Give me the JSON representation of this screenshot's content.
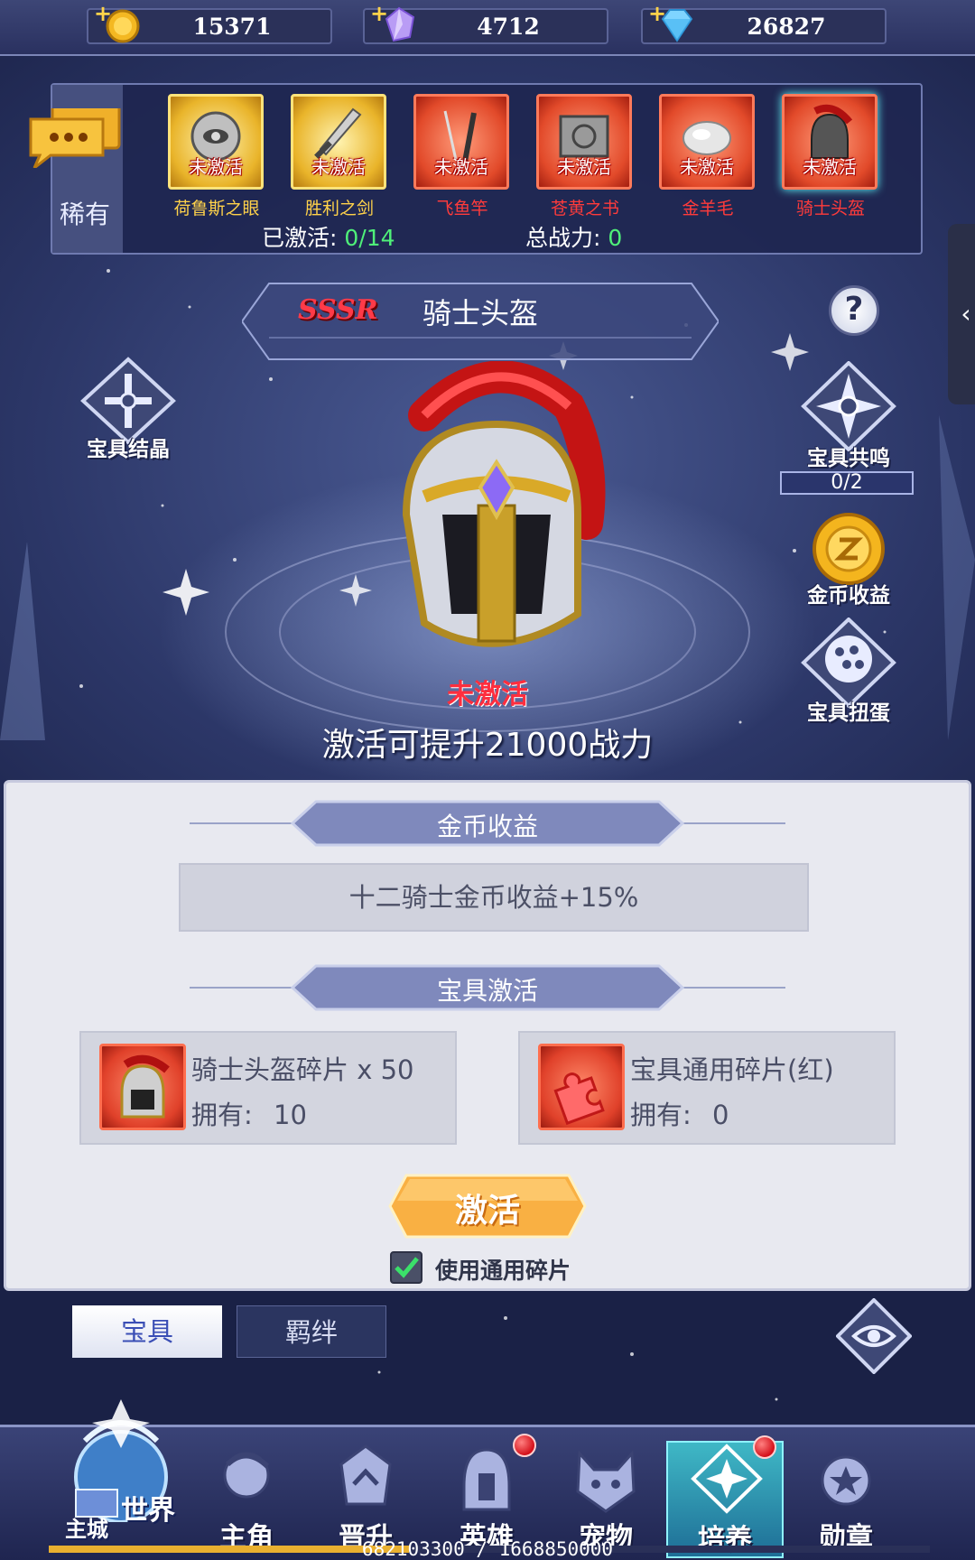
{
  "currencies": [
    {
      "icon": "gold-coin-icon",
      "value": "15371"
    },
    {
      "icon": "purple-crystal-icon",
      "value": "4712"
    },
    {
      "icon": "blue-diamond-icon",
      "value": "26827"
    }
  ],
  "strip": {
    "rarity": "稀有",
    "slots": [
      {
        "name": "荷鲁斯之眼",
        "status": "未激活",
        "frame": "gold"
      },
      {
        "name": "胜利之剑",
        "status": "未激活",
        "frame": "gold"
      },
      {
        "name": "飞鱼竿",
        "status": "未激活",
        "frame": "red"
      },
      {
        "name": "苍黄之书",
        "status": "未激活",
        "frame": "red"
      },
      {
        "name": "金羊毛",
        "status": "未激活",
        "frame": "red"
      },
      {
        "name": "骑士头盔",
        "status": "未激活",
        "frame": "red"
      }
    ],
    "activated_label": "已激活:",
    "activated_value": "0/14",
    "power_label": "总战力:",
    "power_value": "0"
  },
  "artifact": {
    "grade": "SSSR",
    "name": "骑士头盔",
    "status": "未激活",
    "boost_text": "激活可提升21000战力"
  },
  "side": {
    "crystal_label": "宝具结晶",
    "resonance_label": "宝具共鸣",
    "resonance_count": "0/2",
    "coin_income_label": "金币收益",
    "gacha_label": "宝具扭蛋",
    "help": "?",
    "edge_arrow": "‹"
  },
  "panel": {
    "income_title": "金币收益",
    "income_text": "十二骑士金币收益+15%",
    "activate_title": "宝具激活",
    "materials": [
      {
        "name": "骑士头盔碎片 x 50",
        "own_label": "拥有:",
        "own_value": "10"
      },
      {
        "name": "宝具通用碎片(红)",
        "own_label": "拥有:",
        "own_value": "0"
      }
    ],
    "activate_button": "激活",
    "use_common_label": "使用通用碎片",
    "use_common_checked": true
  },
  "tabs": {
    "artifact": "宝具",
    "bond": "羁绊"
  },
  "nav": {
    "world": "世界",
    "main_city": "主城",
    "items": [
      {
        "label": "主角",
        "badge": false
      },
      {
        "label": "晋升",
        "badge": false
      },
      {
        "label": "英雄",
        "badge": true
      },
      {
        "label": "宠物",
        "badge": false
      },
      {
        "label": "培养",
        "badge": true,
        "active": true
      },
      {
        "label": "勋章",
        "badge": false
      }
    ]
  },
  "footer": {
    "exp": "682103300 / 1668850000",
    "progress": 0.4087
  }
}
